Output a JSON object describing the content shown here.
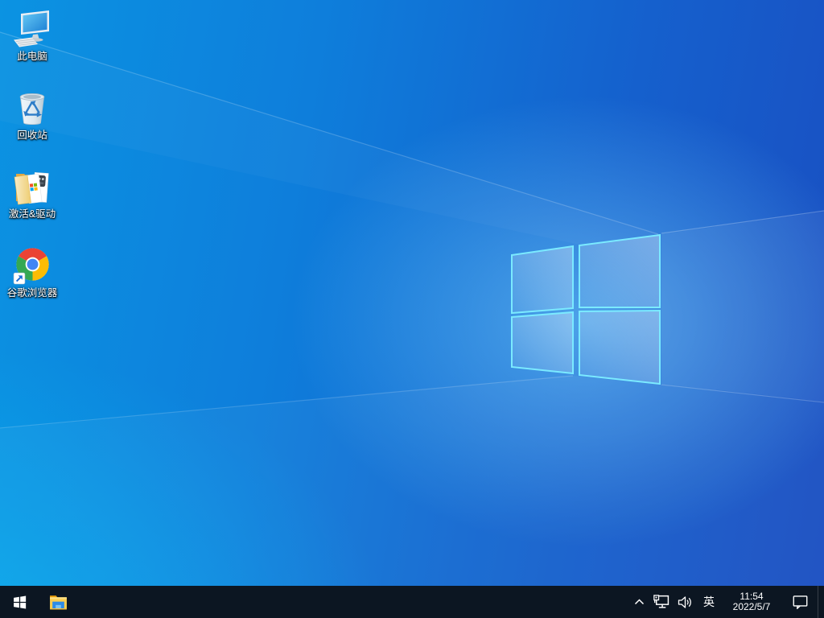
{
  "wallpaper": {
    "name": "windows-10-light-rays-default",
    "colors": {
      "sky_left": "#0b93e2",
      "sky_right": "#1a4ec1",
      "bottom_left_glow": "#00d7ff",
      "logo_glow": "#7dd7ff",
      "logo_edge": "#7beaff"
    }
  },
  "desktop_icons": [
    {
      "id": "this-pc",
      "label": "此电脑"
    },
    {
      "id": "recycle-bin",
      "label": "回收站"
    },
    {
      "id": "activation-drivers-folder",
      "label": "激活&驱动"
    },
    {
      "id": "google-chrome",
      "label": "谷歌浏览器"
    }
  ],
  "taskbar": {
    "background": "#0c1622",
    "buttons": [
      {
        "id": "start-button",
        "icon": "windows-flag-icon"
      },
      {
        "id": "file-explorer-button",
        "icon": "folder-icon"
      }
    ],
    "tray": {
      "hidden_icons": {
        "icon": "chevron-up-icon"
      },
      "network": {
        "icon": "wired-network-icon"
      },
      "volume": {
        "icon": "speaker-icon"
      },
      "language_indicator": "英",
      "clock": {
        "time": "11:54",
        "date": "2022/5/7"
      },
      "action_center": {
        "icon": "notification-bubble-icon"
      }
    }
  }
}
